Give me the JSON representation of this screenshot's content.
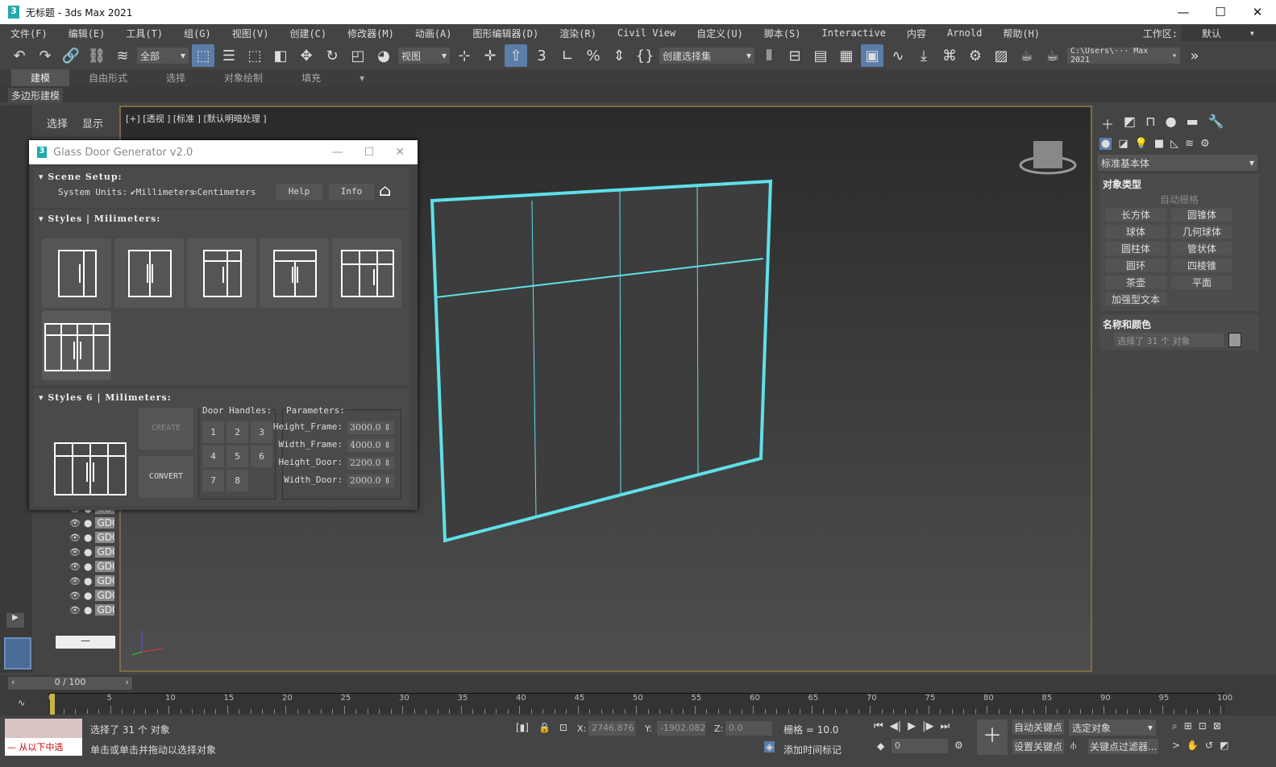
{
  "window": {
    "title": "无标题 - 3ds Max 2021",
    "controls": [
      "—",
      "☐",
      "✕"
    ]
  },
  "menu": [
    "文件(F)",
    "编辑(E)",
    "工具(T)",
    "组(G)",
    "视图(V)",
    "创建(C)",
    "修改器(M)",
    "动画(A)",
    "图形编辑器(D)",
    "渲染(R)",
    "Civil View",
    "自定义(U)",
    "脚本(S)",
    "Interactive",
    "内容",
    "Arnold",
    "帮助(H)"
  ],
  "workspace": {
    "label": "工作区:",
    "value": "默认"
  },
  "toolbar": {
    "filter": "全部",
    "ref_coord": "视图",
    "selection_set": "创建选择集",
    "path": "C:\\Users\\··· Max 2021"
  },
  "ribbon": {
    "tabs": [
      "建模",
      "自由形式",
      "选择",
      "对象绘制",
      "填充"
    ],
    "active": "建模",
    "sub": "多边形建模"
  },
  "explorer": {
    "tabs": [
      "选择",
      "显示"
    ],
    "items": [
      "GDC",
      "GDC",
      "GDC",
      "GDC",
      "GDC",
      "GDC",
      "GDC",
      "GDC"
    ]
  },
  "viewport": {
    "label": "[+] [透视 ] [标准 ] [默认明暗处理 ]",
    "selection_color": "#5fe0e8"
  },
  "dialog": {
    "title": "Glass Door Generator v2.0",
    "scene_setup": {
      "title": "Scene Setup:",
      "units_label": "System Units:",
      "millimeters": "Millimeters",
      "millimeters_checked": true,
      "centimeters": "Centimeters",
      "centimeters_checked": false,
      "help": "Help",
      "info": "Info"
    },
    "styles": {
      "title": "Styles | Milimeters:",
      "count": 6
    },
    "styles6": {
      "title": "Styles 6 | Milimeters:",
      "create": "CREATE",
      "convert": "CONVERT",
      "handles_label": "Door Handles:",
      "handles": [
        "1",
        "2",
        "3",
        "4",
        "5",
        "6",
        "7",
        "8"
      ],
      "params_label": "Parameters:",
      "params": [
        {
          "label": "Height_Frame:",
          "value": "3000.0"
        },
        {
          "label": "Width_Frame:",
          "value": "4000.0"
        },
        {
          "label": "Height_Door:",
          "value": "2200.0"
        },
        {
          "label": "Width_Door:",
          "value": "2000.0"
        }
      ]
    }
  },
  "command_panel": {
    "dropdown": "标准基本体",
    "object_type": "对象类型",
    "autogrid": "自动栅格",
    "buttons": [
      "长方体",
      "圆锥体",
      "球体",
      "几何球体",
      "圆柱体",
      "管状体",
      "圆环",
      "四棱锥",
      "茶壶",
      "平面",
      "加强型文本"
    ],
    "name_color": "名称和颜色",
    "name_value": "选择了 31 个 对象"
  },
  "timeline": {
    "frame": "0 / 100",
    "ticks": [
      "0",
      "5",
      "10",
      "15",
      "20",
      "25",
      "30",
      "35",
      "40",
      "45",
      "50",
      "55",
      "60",
      "65",
      "70",
      "75",
      "80",
      "85",
      "90",
      "95",
      "100"
    ]
  },
  "status": {
    "selected": "选择了 31 个 对象",
    "hint": "单击或单击并拖动以选择对象",
    "script": "从以下中选",
    "x_label": "X:",
    "x": "2746.876",
    "y_label": "Y:",
    "y": "-1902.082",
    "z_label": "Z:",
    "z": "0.0",
    "grid": "栅格 = 10.0",
    "add_time_tag": "添加时间标记",
    "auto_key": "自动关键点",
    "set_key": "设置关键点",
    "key_mode": "选定对象",
    "key_filters": "关键点过滤器...",
    "frame": "0"
  }
}
